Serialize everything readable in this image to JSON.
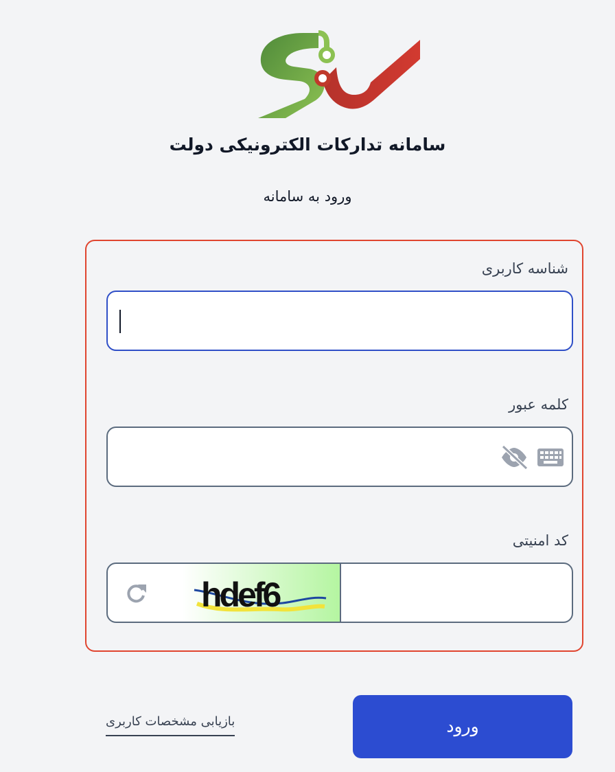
{
  "header": {
    "title": "سامانه تدارکات الکترونیکی دولت",
    "subtitle": "ورود به سامانه"
  },
  "form": {
    "username": {
      "label": "شناسه کاربری",
      "value": ""
    },
    "password": {
      "label": "کلمه عبور",
      "value": "",
      "icons": [
        "eye-off-icon",
        "keyboard-icon"
      ]
    },
    "captcha": {
      "label": "کد امنیتی",
      "image_text": "hdef6",
      "value": "",
      "icons": [
        "refresh-icon"
      ]
    }
  },
  "actions": {
    "login_label": "ورود",
    "recover_label": "بازیابی مشخصات کاربری"
  },
  "colors": {
    "primary": "#2c4cd1",
    "form_border": "#e0452f",
    "focus_border": "#2f4fc7",
    "logo_green": "#6aa84f",
    "logo_red": "#c0392b"
  }
}
